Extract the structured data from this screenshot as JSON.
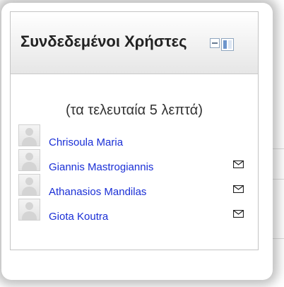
{
  "block": {
    "title": "Συνδεδεμένοι Χρήστες",
    "subtitle": "(τα τελευταία 5 λεπτά)",
    "dock_icon": "dock-block-icon",
    "users": [
      {
        "name": "Chrisoula Maria",
        "avatar_icon": "user-avatar-icon",
        "message_icon": null
      },
      {
        "name": "Giannis Mastrogiannis",
        "avatar_icon": "user-avatar-icon",
        "message_icon": "envelope-icon"
      },
      {
        "name": "Athanasios Mandilas",
        "avatar_icon": "user-avatar-icon",
        "message_icon": "envelope-icon"
      },
      {
        "name": "Giota Koutra",
        "avatar_icon": "user-avatar-icon",
        "message_icon": "envelope-icon"
      }
    ]
  },
  "colors": {
    "link": "#1a2fd6",
    "header_bg": "#e6e6e6",
    "border": "#c4c4c4"
  }
}
